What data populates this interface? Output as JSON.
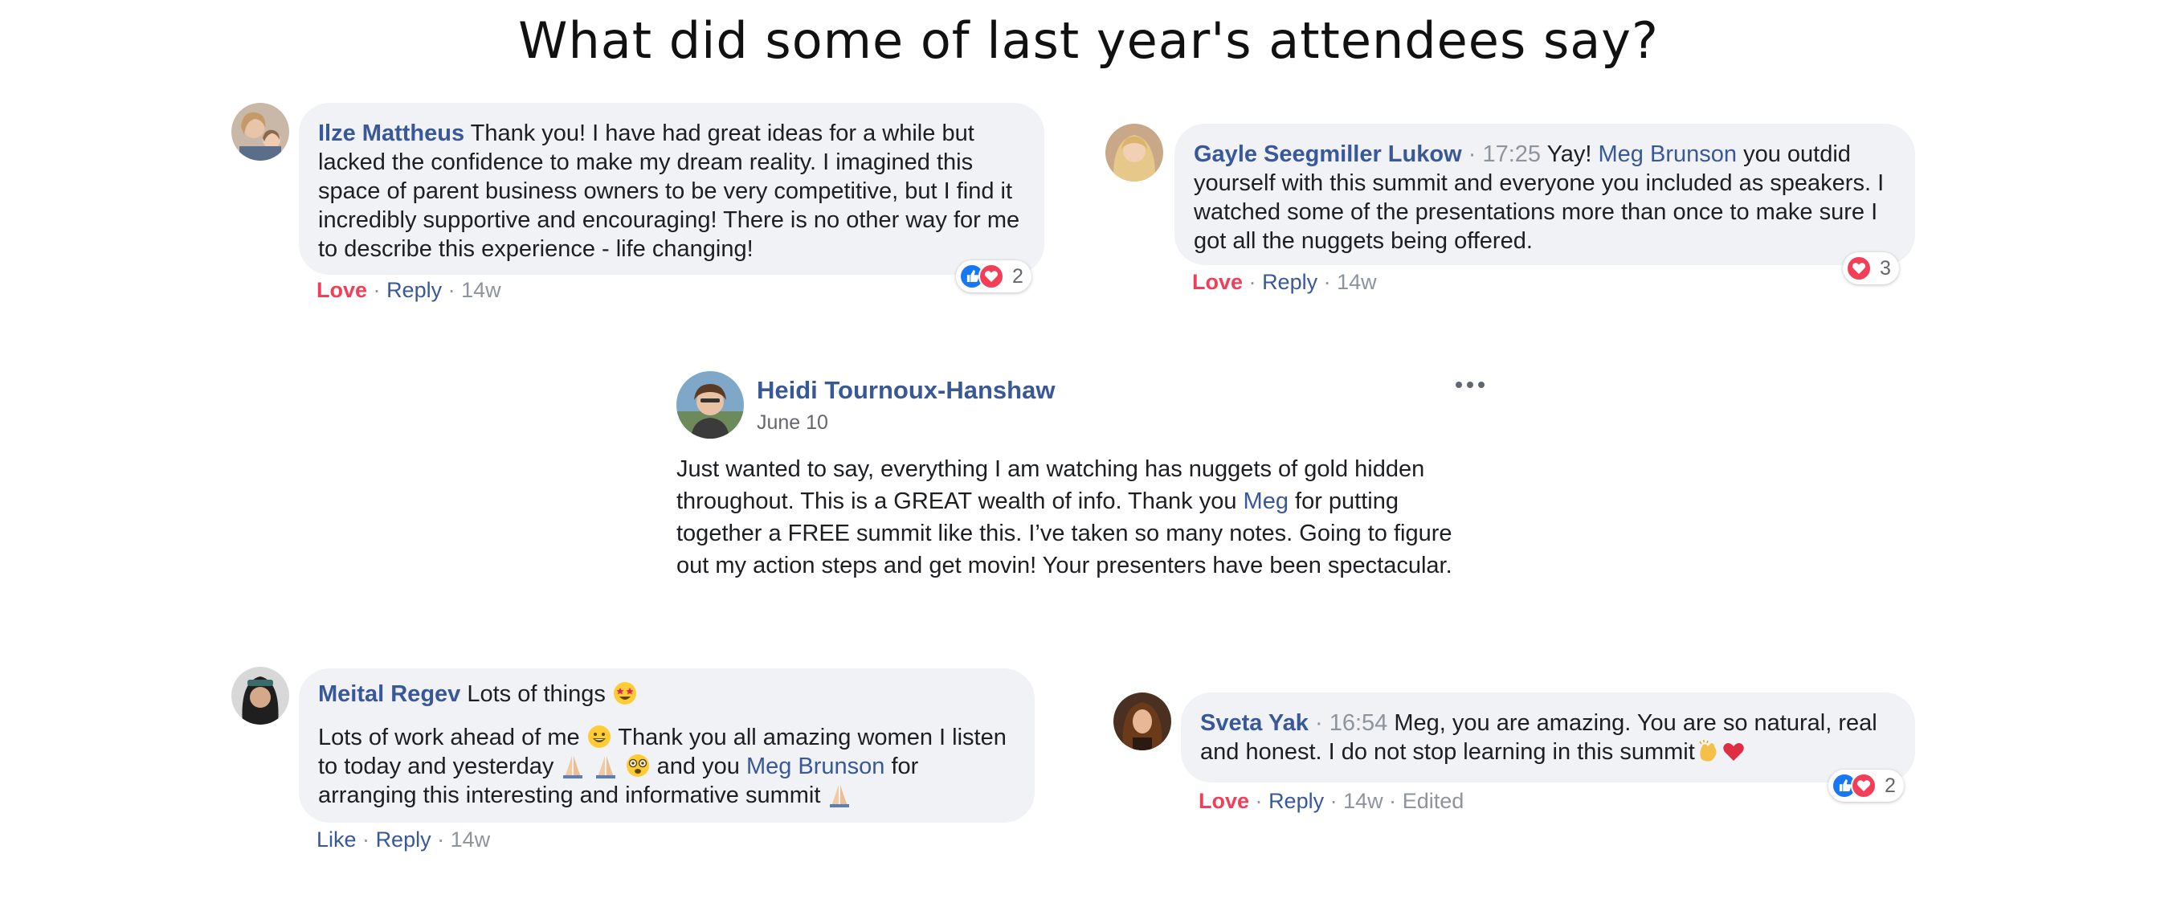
{
  "page_title": "What did some of last year's attendees say?",
  "comment1": {
    "author": "Ilze Mattheus",
    "text": "Thank you! I have had great ideas for a while but lacked the confidence to make my dream reality. I imagined this space of parent business owners to be very competitive, but I find it incredibly supportive and encouraging! There is no other way for me to describe this experience - life changing!",
    "reaction_count": "2",
    "action_reaction": "Love",
    "action_reply": "Reply",
    "time": "14w"
  },
  "comment2": {
    "author": "Gayle Seegmiller Lukow",
    "timestamp": "17:25",
    "text_before": "Yay!",
    "mention": "Meg Brunson",
    "text_after": "you outdid yourself with this summit and everyone you included as speakers. I watched some of the presentations more than once to make sure I got all the nuggets being offered.",
    "reaction_count": "3",
    "action_reaction": "Love",
    "action_reply": "Reply",
    "time": "14w"
  },
  "post": {
    "author": "Heidi Tournoux-Hanshaw",
    "date": "June 10",
    "text_before": "Just wanted to say, everything I am watching has nuggets of gold hidden throughout. This is a GREAT wealth of info. Thank you",
    "mention": "Meg",
    "text_after": "for putting together a FREE summit like this. I’ve taken so many notes. Going to figure out my action steps and get movin! Your presenters have been spectacular."
  },
  "comment3": {
    "author": "Meital Regev",
    "line1": "Lots of things",
    "text_a": "Lots of work ahead of me",
    "text_b": "Thank you all amazing women I listen to today and yesterday",
    "text_c": "and you",
    "mention": "Meg Brunson",
    "text_d": "for arranging this interesting and informative summit",
    "action_reaction": "Like",
    "action_reply": "Reply",
    "time": "14w"
  },
  "comment4": {
    "author": "Sveta Yak",
    "timestamp": "16:54",
    "text": "Meg, you are amazing. You are so natural, real and honest. I do not stop learning in this summit",
    "reaction_count": "2",
    "action_reaction": "Love",
    "action_reply": "Reply",
    "time": "14w",
    "edited": "Edited"
  },
  "separator": "·",
  "colors": {
    "link_blue": "#385898",
    "love_red": "#f33e58",
    "like_blue": "#1877f2",
    "bubble_bg": "#f0f2f5",
    "meta_gray": "#8d949e"
  },
  "icons": [
    "like-reaction-icon",
    "love-reaction-icon",
    "more-options-icon",
    "star-struck-emoji",
    "grinning-emoji",
    "folded-hands-emoji",
    "dizzy-face-emoji",
    "clapping-hands-emoji",
    "red-heart-emoji"
  ]
}
